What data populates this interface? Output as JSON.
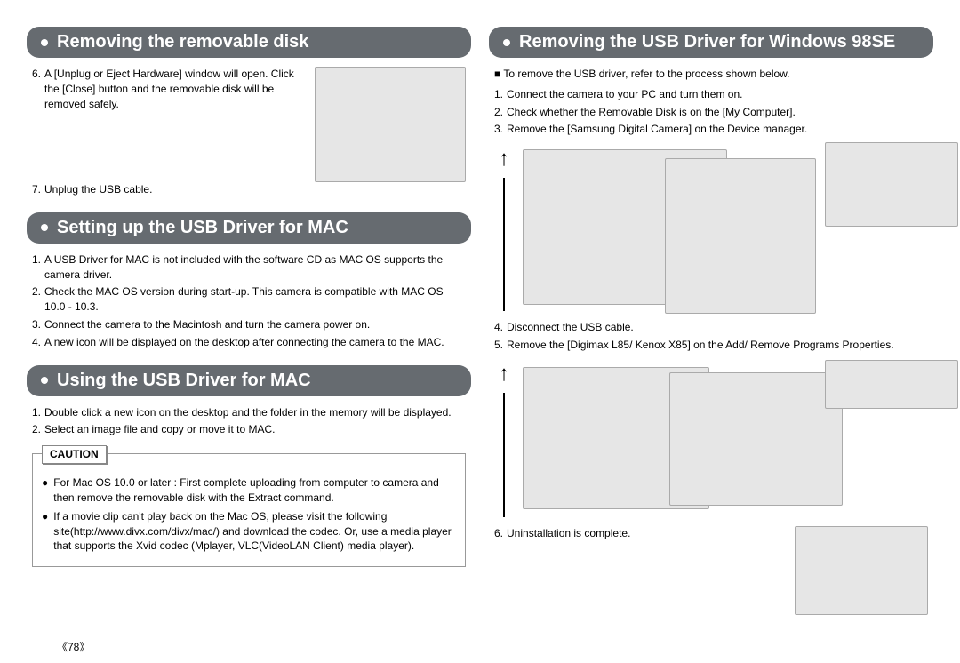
{
  "page_number": "《78》",
  "left": {
    "sec1": {
      "title": "Removing the removable disk",
      "items": [
        {
          "n": "6.",
          "t": "A [Unplug or Eject Hardware] window will open. Click the [Close] button and the removable disk will be removed safely."
        },
        {
          "n": "7.",
          "t": "Unplug the USB cable."
        }
      ]
    },
    "sec2": {
      "title": "Setting up the USB Driver for MAC",
      "items": [
        {
          "n": "1.",
          "t": "A USB Driver for MAC is not included with the software CD as MAC OS supports the camera driver."
        },
        {
          "n": "2.",
          "t": "Check the MAC OS version during start-up. This camera is compatible with MAC OS 10.0 - 10.3."
        },
        {
          "n": "3.",
          "t": "Connect the camera to the Macintosh and turn the camera power on."
        },
        {
          "n": "4.",
          "t": "A new icon will be displayed on the desktop after connecting the camera to the MAC."
        }
      ]
    },
    "sec3": {
      "title": "Using the USB Driver for MAC",
      "items": [
        {
          "n": "1.",
          "t": "Double click a new icon on the desktop and the folder in the memory will be displayed."
        },
        {
          "n": "2.",
          "t": "Select an image file and copy or move it to MAC."
        }
      ],
      "caution_label": "CAUTION",
      "caution": [
        "For Mac OS 10.0 or later : First complete uploading from computer to camera and then remove the removable disk with the Extract command.",
        "If a movie clip can't play back on the Mac OS, please visit the following site(http://www.divx.com/divx/mac/) and download the codec. Or, use a media player that supports the Xvid codec (Mplayer, VLC(VideoLAN Client) media player)."
      ]
    }
  },
  "right": {
    "sec1": {
      "title": "Removing the USB Driver for Windows 98SE",
      "intro": "■ To remove the USB driver, refer to the process shown below.",
      "items_a": [
        {
          "n": "1.",
          "t": "Connect the camera to your PC and turn them on."
        },
        {
          "n": "2.",
          "t": "Check whether the Removable Disk is on the [My Computer]."
        },
        {
          "n": "3.",
          "t": "Remove the [Samsung Digital Camera] on the Device manager."
        }
      ],
      "items_b": [
        {
          "n": "4.",
          "t": "Disconnect the USB cable."
        },
        {
          "n": "5.",
          "t": "Remove the [Digimax L85/ Kenox X85] on the Add/ Remove Programs Properties."
        }
      ],
      "items_c": [
        {
          "n": "6.",
          "t": "Uninstallation is complete."
        }
      ]
    }
  }
}
